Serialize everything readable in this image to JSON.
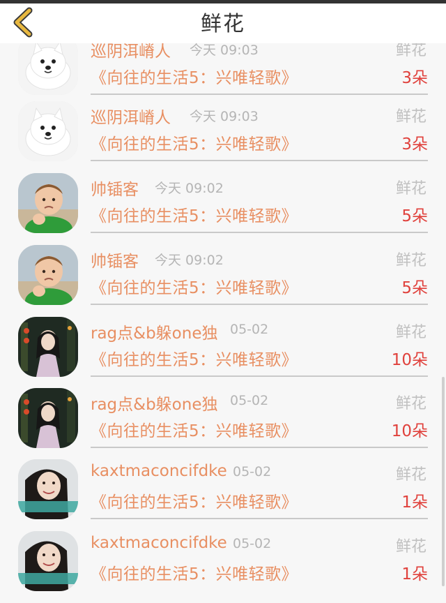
{
  "navbar": {
    "title": "鲜花",
    "back_icon": "chevron-left-icon",
    "accent_color": "#e8b840"
  },
  "list": {
    "items": [
      {
        "user": "巡阴洱嵴人",
        "time": "今天 09:03",
        "gift": "鲜花",
        "program": "《向往的生活5：兴唯轻歌》",
        "count": "3朵",
        "avatar": "white-dog"
      },
      {
        "user": "巡阴洱嵴人",
        "time": "今天 09:03",
        "gift": "鲜花",
        "program": "《向往的生活5：兴唯轻歌》",
        "count": "3朵",
        "avatar": "white-dog"
      },
      {
        "user": "帅锸客",
        "time": "今天 09:02",
        "gift": "鲜花",
        "program": "《向往的生活5：兴唯轻歌》",
        "count": "5朵",
        "avatar": "baby-fist"
      },
      {
        "user": "帅锸客",
        "time": "今天 09:02",
        "gift": "鲜花",
        "program": "《向往的生活5：兴唯轻歌》",
        "count": "5朵",
        "avatar": "baby-fist"
      },
      {
        "user": "rag点&b躲one独",
        "time": "05-02",
        "gift": "鲜花",
        "program": "《向往的生活5：兴唯轻歌》",
        "count": "10朵",
        "avatar": "girl-night"
      },
      {
        "user": "rag点&b躲one独",
        "time": "05-02",
        "gift": "鲜花",
        "program": "《向往的生活5：兴唯轻歌》",
        "count": "10朵",
        "avatar": "girl-night"
      },
      {
        "user": "kaxtmaconcifdke",
        "time": "05-02",
        "gift": "鲜花",
        "program": "《向往的生活5：兴唯轻歌》",
        "count": "1朵",
        "avatar": "woman-smile"
      },
      {
        "user": "kaxtmaconcifdke",
        "time": "05-02",
        "gift": "鲜花",
        "program": "《向往的生活5：兴唯轻歌》",
        "count": "1朵",
        "avatar": "woman-smile"
      }
    ]
  },
  "colors": {
    "name": "#e88f62",
    "count": "#e0413c",
    "meta": "#b5b5b5"
  }
}
